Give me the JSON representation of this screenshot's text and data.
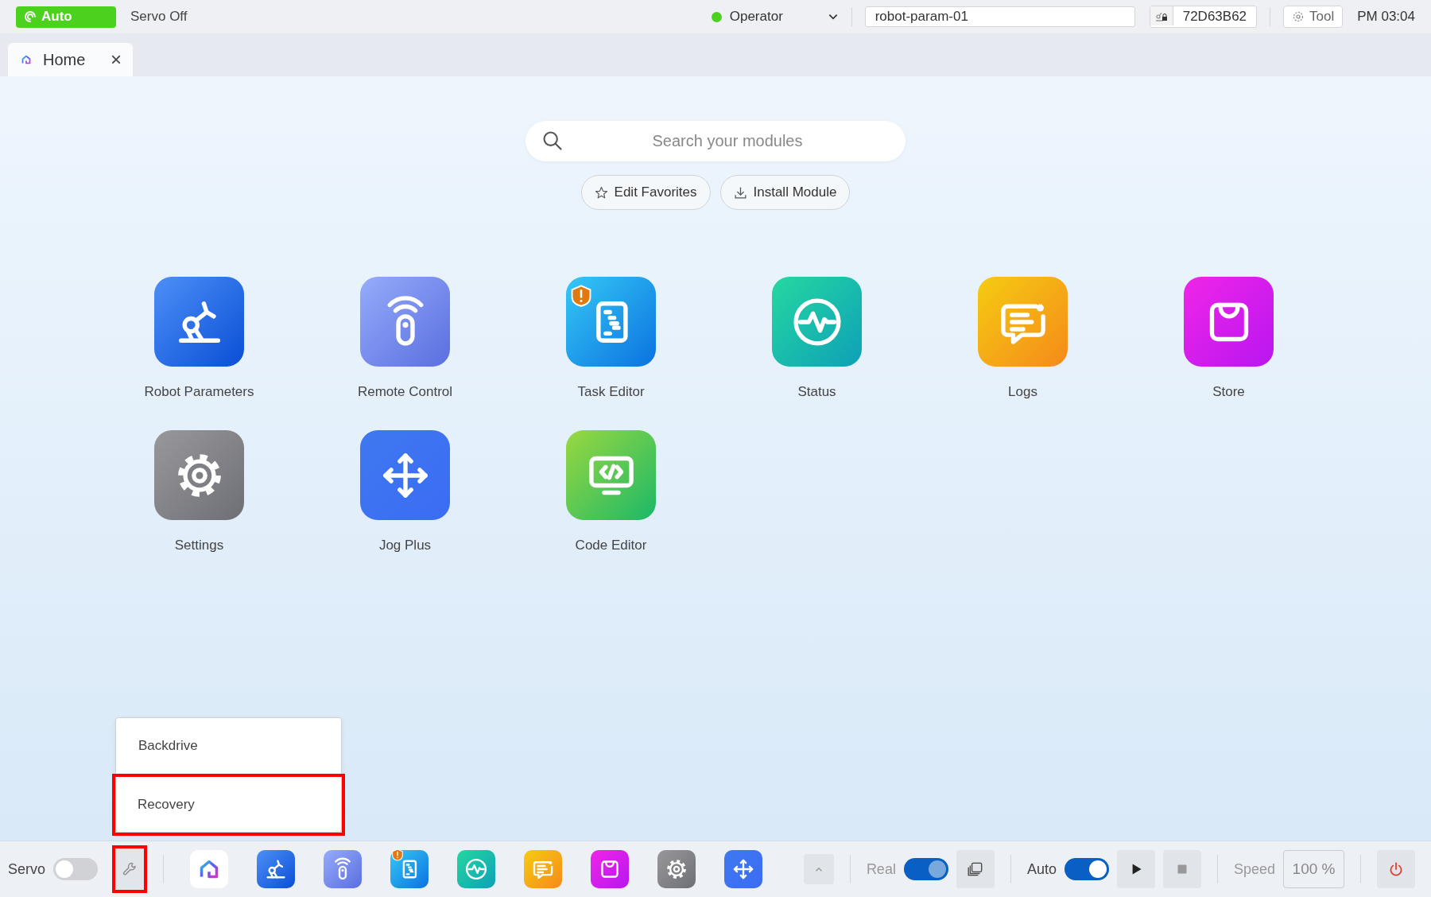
{
  "top_bar": {
    "mode": {
      "label": "Auto"
    },
    "servo_status": "Servo Off",
    "user": {
      "role": "Operator",
      "online": true
    },
    "robot_name": "robot-param-01",
    "serial": "72D63B62",
    "tool_button": "Tool",
    "clock": "PM 03:04"
  },
  "tabs": [
    {
      "label": "Home",
      "selected": true,
      "close": "×"
    }
  ],
  "search": {
    "placeholder": "Search your modules"
  },
  "actions": [
    "Edit Favorites",
    "Install Module"
  ],
  "apps": [
    {
      "kind": "robot",
      "label": "Robot Parameters",
      "warning": false
    },
    {
      "kind": "remote",
      "label": "Remote Control",
      "warning": false
    },
    {
      "kind": "task",
      "label": "Task Editor",
      "warning": true
    },
    {
      "kind": "status",
      "label": "Status",
      "warning": false
    },
    {
      "kind": "logs",
      "label": "Logs",
      "warning": false
    },
    {
      "kind": "store",
      "label": "Store",
      "warning": false
    },
    {
      "kind": "settings",
      "label": "Settings",
      "warning": false
    },
    {
      "kind": "jog",
      "label": "Jog Plus",
      "warning": false
    },
    {
      "kind": "code",
      "label": "Code Editor",
      "warning": false
    }
  ],
  "popup_menu": [
    {
      "label": "Backdrive",
      "highlighted": false
    },
    {
      "label": "Recovery",
      "highlighted": true
    }
  ],
  "bottom_bar": {
    "servo": {
      "label": "Servo",
      "on": false
    },
    "wrench_highlighted": true,
    "dock": [
      {
        "kind": "home",
        "warning": false
      },
      {
        "kind": "robot",
        "warning": false
      },
      {
        "kind": "remote",
        "warning": false
      },
      {
        "kind": "task",
        "warning": true
      },
      {
        "kind": "status",
        "warning": false
      },
      {
        "kind": "logs",
        "warning": false
      },
      {
        "kind": "store",
        "warning": false
      },
      {
        "kind": "settings",
        "warning": false
      },
      {
        "kind": "jog",
        "warning": false
      }
    ],
    "real": {
      "label": "Real",
      "on": true
    },
    "auto": {
      "label": "Auto",
      "on": true
    },
    "speed_label": "Speed",
    "speed_value": "100 %"
  }
}
